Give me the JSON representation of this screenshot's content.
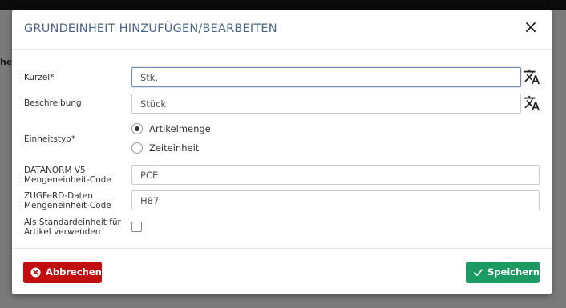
{
  "background": {
    "fragment_text": "heit"
  },
  "dialog": {
    "title": "GRUNDEINHEIT HINZUFÜGEN/BEARBEITEN",
    "close_glyph": "×"
  },
  "form": {
    "kuerzel": {
      "label": "Kürzel*",
      "value": "Stk.",
      "focused": true
    },
    "beschreibung": {
      "label": "Beschreibung",
      "value": "Stück"
    },
    "einheitstyp": {
      "label": "Einheitstyp*",
      "options": [
        {
          "label": "Artikelmenge",
          "checked": true
        },
        {
          "label": "Zeiteinheit",
          "checked": false
        }
      ]
    },
    "datanorm": {
      "label_line1": "DATANORM V5",
      "label_line2": "Mengeneinheit-Code",
      "value": "PCE"
    },
    "zugferd": {
      "label_line1": "ZUGFeRD-Daten",
      "label_line2": "Mengeneinheit-Code",
      "value": "H87"
    },
    "standard": {
      "label_line1": "Als Standardeinheit für",
      "label_line2": "Artikel verwenden",
      "checked": false
    }
  },
  "footer": {
    "cancel_label": "Abbrechen",
    "save_label": "Speichern"
  },
  "icons": [
    "translate-icon",
    "close-icon",
    "cancel-circle-icon",
    "check-icon"
  ],
  "colors": {
    "title": "#4a6488",
    "cancel": "#c20e0e",
    "save": "#1b9a62",
    "focus_border": "#6d8bb3"
  }
}
